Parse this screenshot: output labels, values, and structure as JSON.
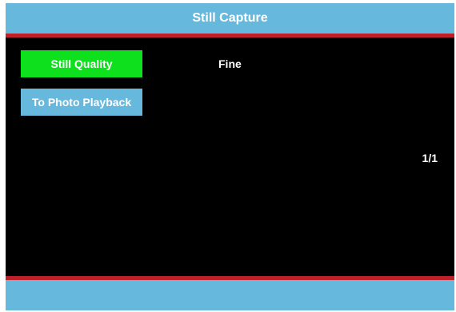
{
  "header": {
    "title": "Still Capture"
  },
  "menu": {
    "items": [
      {
        "label": "Still Quality",
        "selected": true
      },
      {
        "label": "To Photo Playback",
        "selected": false
      }
    ]
  },
  "setting": {
    "value": "Fine"
  },
  "pagination": {
    "text": "1/1"
  },
  "colors": {
    "header_bar": "#67b8dd",
    "accent_line": "#c0202a",
    "selected_item": "#0fe01e",
    "normal_item": "#67b8dd",
    "background": "#000000",
    "text": "#ffffff"
  }
}
